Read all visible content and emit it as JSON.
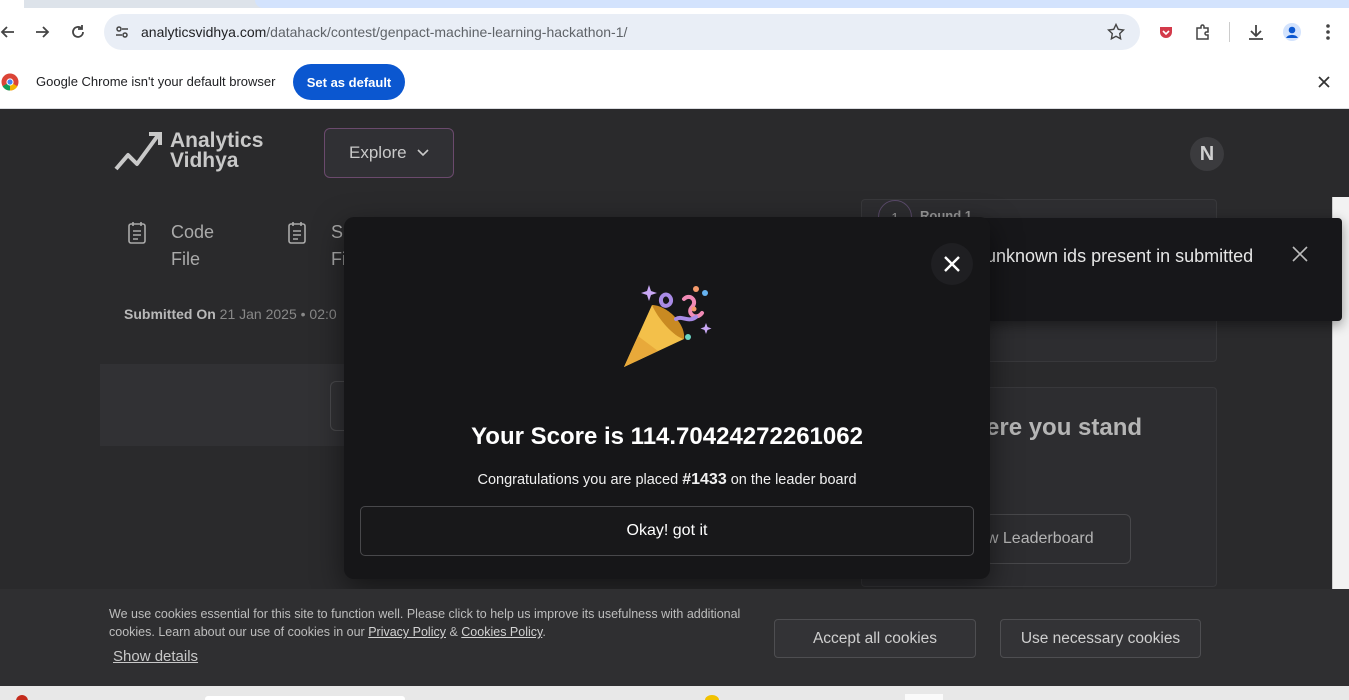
{
  "browser": {
    "url_host": "analyticsvidhya.com",
    "url_path": "/datahack/contest/genpact-machine-learning-hackathon-1/",
    "infobar_message": "Google Chrome isn't your default browser",
    "set_default_label": "Set as default"
  },
  "site": {
    "logo_line1": "Analytics",
    "logo_line2": "Vidhya",
    "explore_label": "Explore",
    "avatar_initial": "N"
  },
  "submission": {
    "code_file_line1": "Code",
    "code_file_line2": "File",
    "sub_file_line1": "S",
    "sub_file_line2": "Fi",
    "submitted_label": "Submitted On",
    "submitted_value": "21 Jan 2025 • 02:0"
  },
  "round": {
    "number": "1",
    "label": "Round 1"
  },
  "stand": {
    "title": "ere you stand",
    "leaderboard_label": "ew Leaderboard"
  },
  "toast": {
    "message": "unknown ids present in submitted"
  },
  "modal": {
    "score_text": "Your Score is 114.70424272261062",
    "congrats_prefix": "Congratulations you are placed ",
    "rank": "#1433",
    "congrats_suffix": " on the leader board",
    "ok_label": "Okay! got it"
  },
  "cookie": {
    "text_part1": "We use cookies essential for this site to function well. Please click to help us improve its usefulness with additional cookies. Learn about our use of cookies in our ",
    "privacy_link": "Privacy Policy",
    "amp": " & ",
    "cookies_link": "Cookies Policy",
    "period": ".",
    "show_details": "Show details",
    "accept_all": "Accept all cookies",
    "use_necessary": "Use necessary cookies"
  }
}
